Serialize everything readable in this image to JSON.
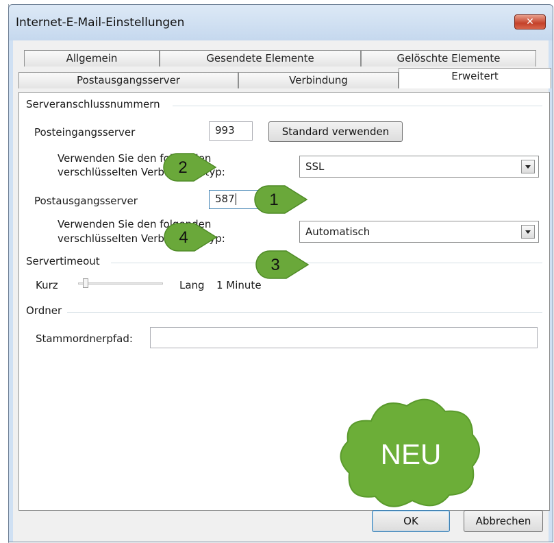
{
  "window": {
    "title": "Internet-E-Mail-Einstellungen"
  },
  "tabs": {
    "row_back": [
      "Allgemein",
      "Gesendete Elemente",
      "Gelöschte Elemente"
    ],
    "row_front": [
      "Postausgangsserver",
      "Verbindung",
      "Erweitert"
    ],
    "active": "Erweitert"
  },
  "server_ports": {
    "group_label": "Serveranschlussnummern",
    "incoming_label": "Posteingangsserver",
    "incoming_port": "993",
    "default_button": "Standard verwenden",
    "incoming_enc_label_1": "Verwenden Sie den folgenden",
    "incoming_enc_label_2": "verschlüsselten Verbindungstyp:",
    "incoming_enc_value": "SSL",
    "outgoing_label": "Postausgangsserver",
    "outgoing_port": "587",
    "outgoing_enc_label_1": "Verwenden Sie den folgenden",
    "outgoing_enc_label_2": "verschlüsselten Verbindungstyp:",
    "outgoing_enc_value": "Automatisch"
  },
  "timeout": {
    "group_label": "Servertimeout",
    "short_label": "Kurz",
    "long_label": "Lang",
    "value": "1 Minute",
    "slider_fraction": 0.06
  },
  "folders": {
    "group_label": "Ordner",
    "root_path_label": "Stammordnerpfad:",
    "root_path_value": ""
  },
  "callouts": [
    "1",
    "2",
    "3",
    "4"
  ],
  "cloud_text": "NEU",
  "footer": {
    "ok_label": "OK",
    "cancel_label": "Abbrechen"
  },
  "colors": {
    "callout_green": "#6aa83a",
    "title_bar": "#cfe0f3",
    "close_red": "#c4412a"
  }
}
